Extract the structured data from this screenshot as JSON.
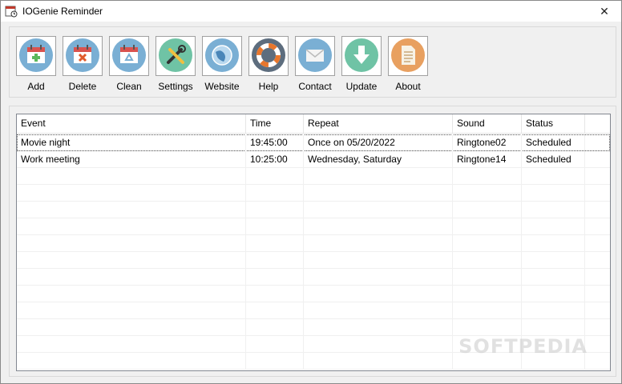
{
  "window": {
    "title": "IOGenie Reminder",
    "app_icon": "calendar-clock-icon",
    "close_glyph": "✕"
  },
  "toolbar": {
    "buttons": [
      {
        "label": "Add",
        "icon": "calendar-add-icon",
        "color": "#7aafd4"
      },
      {
        "label": "Delete",
        "icon": "calendar-delete-icon",
        "color": "#7aafd4"
      },
      {
        "label": "Clean",
        "icon": "calendar-recycle-icon",
        "color": "#7aafd4"
      },
      {
        "label": "Settings",
        "icon": "tools-icon",
        "color": "#6fc3a5"
      },
      {
        "label": "Website",
        "icon": "globe-icon",
        "color": "#7aafd4"
      },
      {
        "label": "Help",
        "icon": "lifebuoy-icon",
        "color": "#5d6d7e"
      },
      {
        "label": "Contact",
        "icon": "envelope-icon",
        "color": "#7aafd4"
      },
      {
        "label": "Update",
        "icon": "download-arrow-icon",
        "color": "#6fc3a5"
      },
      {
        "label": "About",
        "icon": "document-icon",
        "color": "#e8a060"
      }
    ]
  },
  "table": {
    "columns": [
      "Event",
      "Time",
      "Repeat",
      "Sound",
      "Status"
    ],
    "rows": [
      [
        "Movie night",
        "19:45:00",
        "Once on 05/20/2022",
        "Ringtone02",
        "Scheduled"
      ],
      [
        "Work meeting",
        "10:25:00",
        "Wednesday, Saturday",
        "Ringtone14",
        "Scheduled"
      ]
    ]
  },
  "watermark": "SOFTPEDIA"
}
